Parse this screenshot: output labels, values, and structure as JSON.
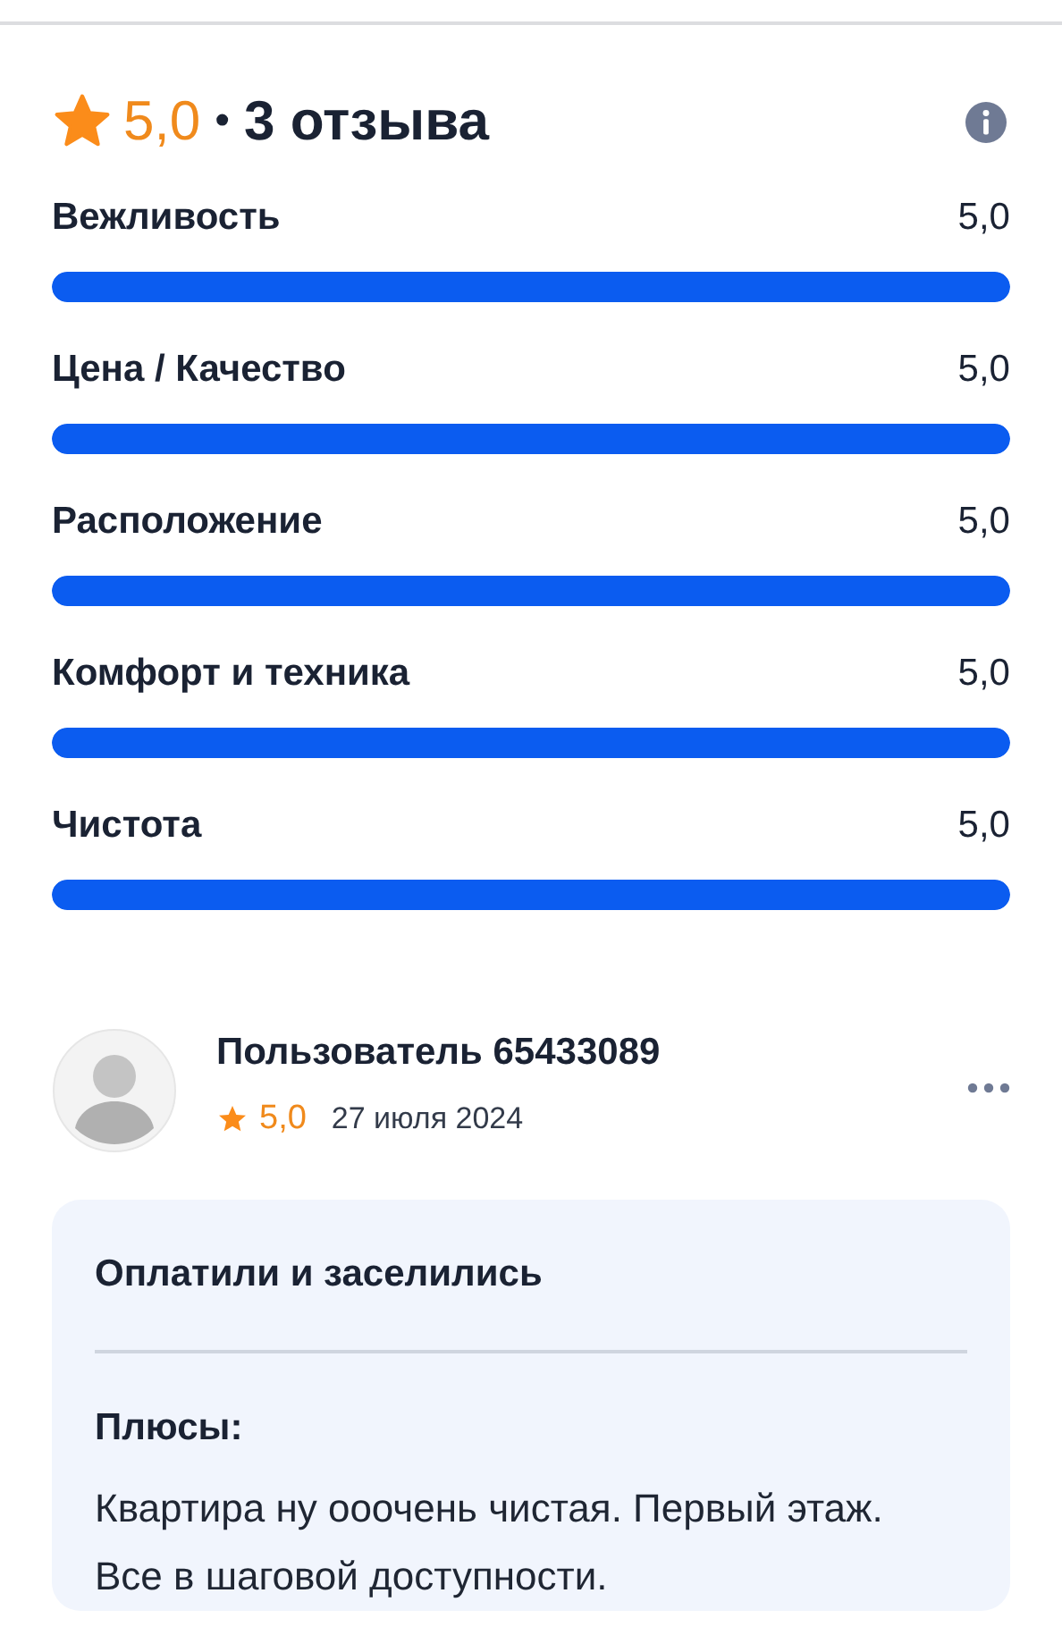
{
  "summary": {
    "rating": "5,0",
    "separator": "•",
    "count": "3 отзыва"
  },
  "categories": [
    {
      "label": "Вежливость",
      "value": "5,0",
      "level": 1
    },
    {
      "label": "Цена / Качество",
      "value": "5,0",
      "level": 1
    },
    {
      "label": "Расположение",
      "value": "5,0",
      "level": 1
    },
    {
      "label": "Комфорт и техника",
      "value": "5,0",
      "level": 1
    },
    {
      "label": "Чистота",
      "value": "5,0",
      "level": 1
    }
  ],
  "review": {
    "author": "Пользователь 65433089",
    "rating": "5,0",
    "date": "27 июля 2024",
    "title": "Оплатили и заселились",
    "pros_label": "Плюсы:",
    "pros_text": "Квартира ну ооочень чистая. Первый этаж. Все в шаговой доступности."
  }
}
